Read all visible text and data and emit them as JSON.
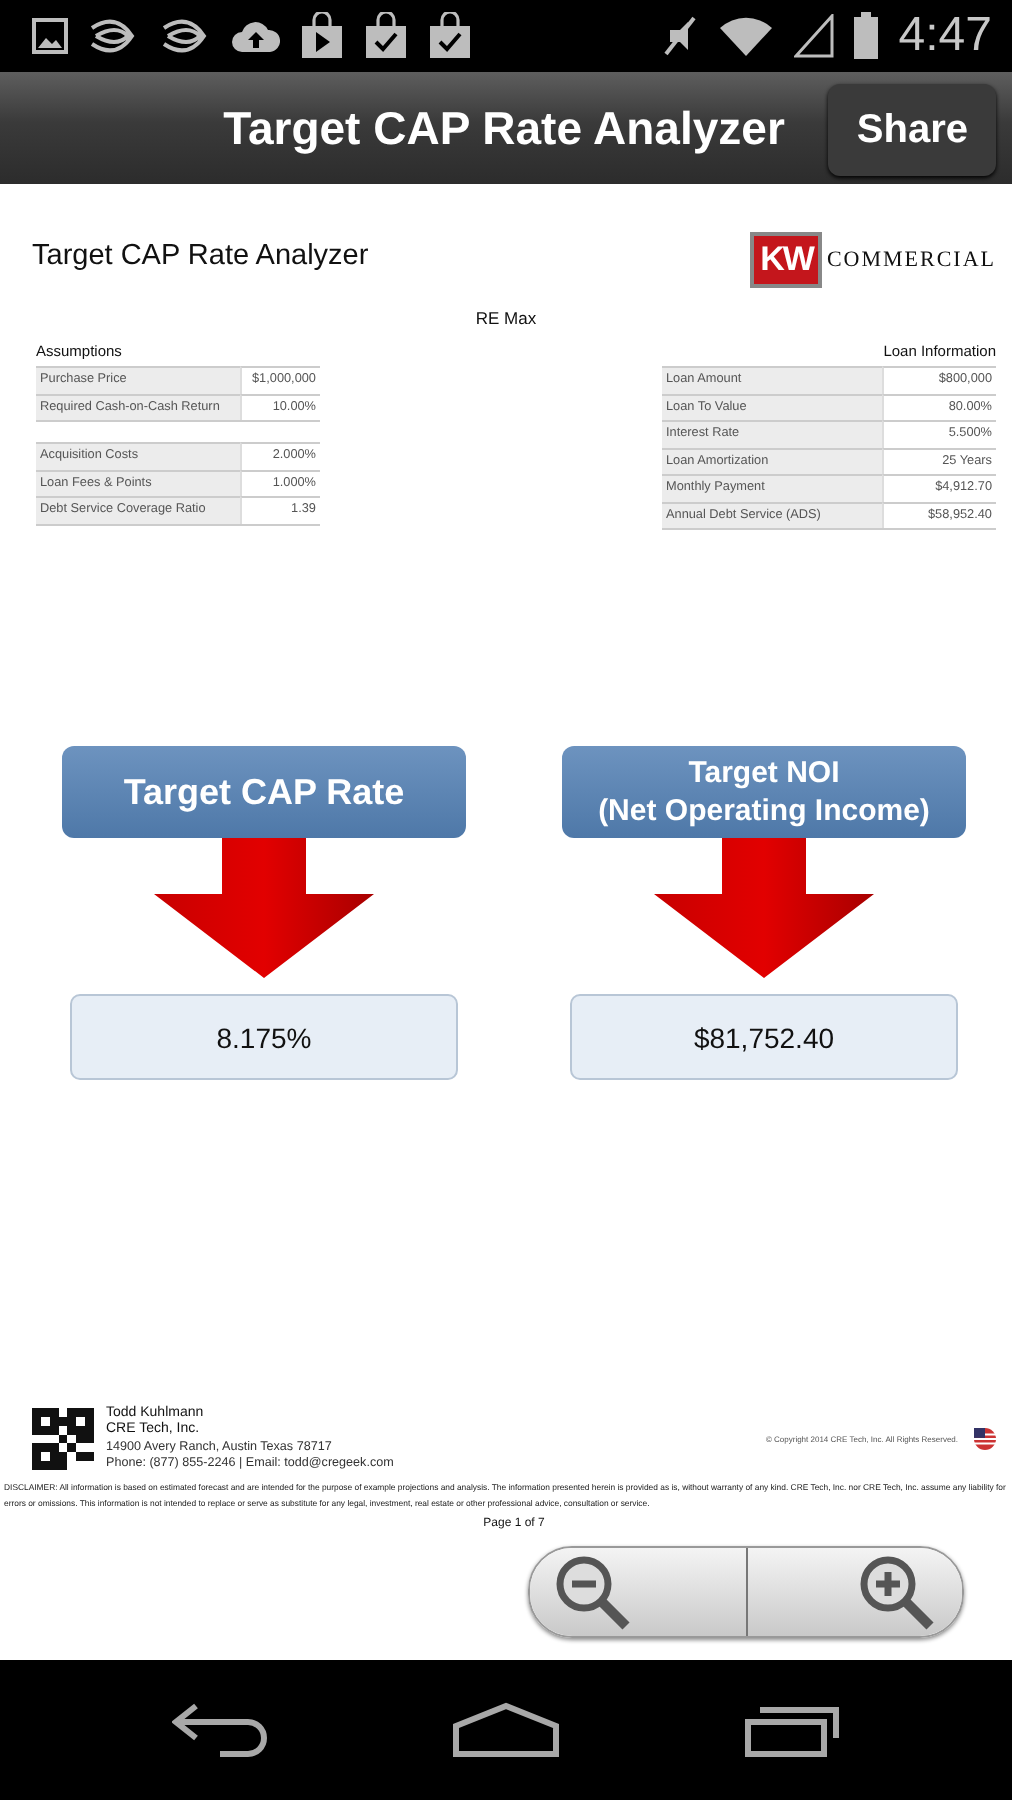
{
  "status_bar": {
    "time": "4:47"
  },
  "action_bar": {
    "title": "Target CAP Rate Analyzer",
    "share_button": "Share"
  },
  "document": {
    "title": "Target CAP Rate Analyzer",
    "logo": {
      "mark": "KW",
      "text": "COMMERCIAL"
    },
    "company": "RE Max",
    "assumptions": {
      "heading": "Assumptions",
      "groups": [
        [
          {
            "label": "Purchase Price",
            "value": "$1,000,000"
          },
          {
            "label": "Required Cash-on-Cash Return",
            "value": "10.00%"
          }
        ],
        [
          {
            "label": "Acquisition Costs",
            "value": "2.000%"
          },
          {
            "label": "Loan Fees & Points",
            "value": "1.000%"
          },
          {
            "label": "Debt Service Coverage Ratio",
            "value": "1.39"
          }
        ]
      ]
    },
    "loan_information": {
      "heading": "Loan Information",
      "rows": [
        {
          "label": "Loan Amount",
          "value": "$800,000"
        },
        {
          "label": "Loan To Value",
          "value": "80.00%"
        },
        {
          "label": "Interest Rate",
          "value": "5.500%"
        },
        {
          "label": "Loan Amortization",
          "value": "25 Years"
        },
        {
          "label": "Monthly Payment",
          "value": "$4,912.70"
        },
        {
          "label": "Annual Debt Service (ADS)",
          "value": "$58,952.40"
        }
      ]
    },
    "results": [
      {
        "heading_lines": [
          "Target CAP Rate"
        ],
        "value": "8.175%"
      },
      {
        "heading_lines": [
          "Target NOI",
          "(Net Operating Income)"
        ],
        "value": "$81,752.40"
      }
    ],
    "footer": {
      "contact_lines": [
        "Todd Kuhlmann",
        "CRE Tech, Inc.",
        "14900 Avery Ranch, Austin Texas 78717",
        "Phone: (877) 855-2246 | Email: todd@cregeek.com"
      ],
      "copyright": "© Copyright 2014 CRE Tech, Inc. All Rights Reserved.",
      "disclaimer": "DISCLAIMER: All information is based on estimated forecast and are intended for the purpose of example projections and analysis. The information presented herein is provided as is, without warranty of any kind. CRE Tech, Inc. nor CRE Tech, Inc. assume any liability for errors or omissions. This information is not intended to replace or serve as substitute for any legal, investment, real estate or other professional advice, consultation or service.",
      "page": "Page 1 of 7"
    }
  }
}
